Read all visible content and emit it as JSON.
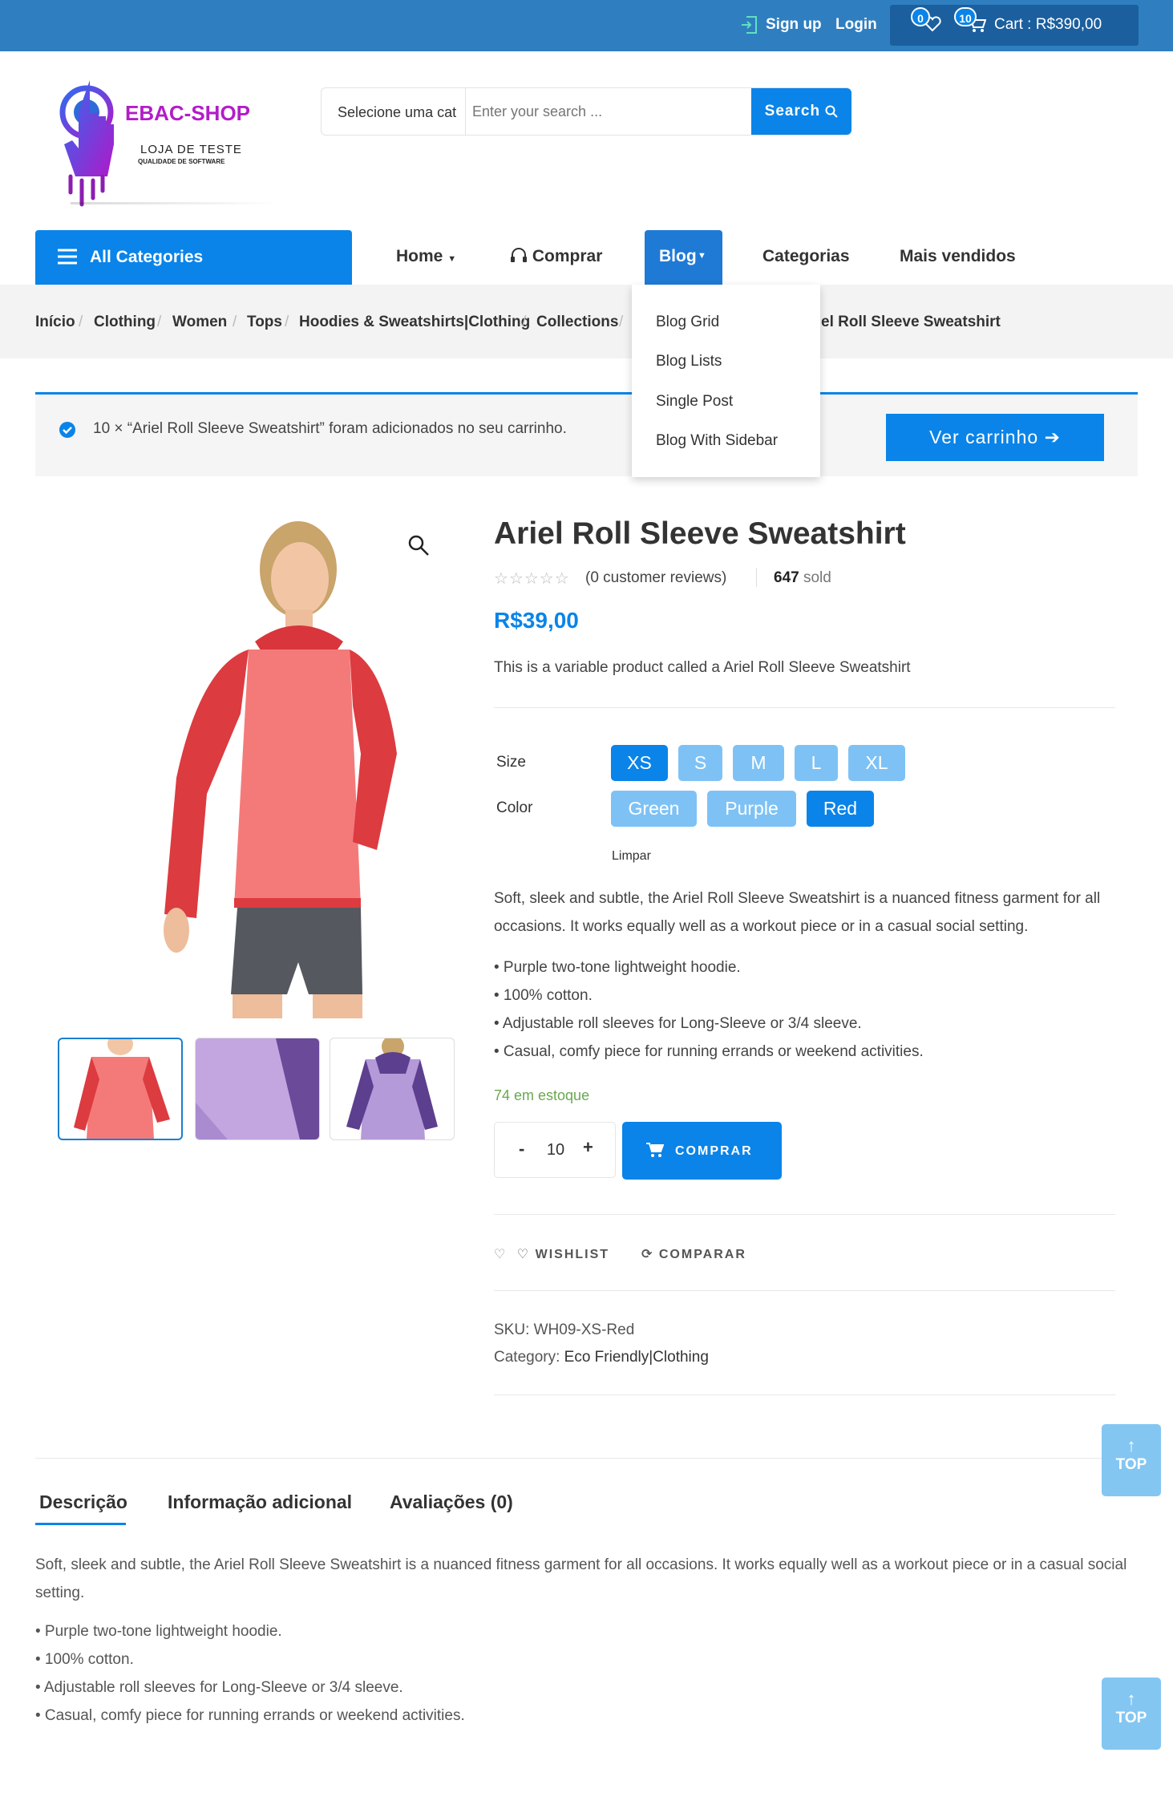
{
  "topbar": {
    "signup": "Sign up",
    "login": "Login",
    "wishlist_count": "0",
    "cart_count": "10",
    "cart_label": "Cart : R$390,00"
  },
  "header": {
    "logo_title": "EBAC-SHOP",
    "logo_sub1": "LOJA DE TESTE",
    "logo_sub2": "QUALIDADE DE SOFTWARE",
    "category_select": "Selecione uma cat",
    "search_placeholder": "Enter your search ...",
    "search_button": "Search"
  },
  "nav": {
    "all_categories": "All Categories",
    "items": [
      "Home",
      "Comprar",
      "Blog",
      "Categorias",
      "Mais vendidos"
    ]
  },
  "blog_menu": [
    "Blog Grid",
    "Blog Lists",
    "Single Post",
    "Blog With Sidebar"
  ],
  "breadcrumb": [
    "Início",
    "Clothing",
    "Women",
    "Tops",
    "Hoodies & Sweatshirts|Clothing",
    "Collections",
    "el Roll Sleeve Sweatshirt"
  ],
  "notice": {
    "message": "10 × “Ariel Roll Sleeve Sweatshirt” foram adicionados no seu carrinho.",
    "button": "Ver carrinho"
  },
  "product": {
    "title": "Ariel Roll Sleeve Sweatshirt",
    "reviews": "(0 customer reviews)",
    "sold_count": "647",
    "sold_label": "sold",
    "price": "R$39,00",
    "short_desc": "This is a variable product called a Ariel Roll Sleeve Sweatshirt",
    "size_label": "Size",
    "sizes": [
      "XS",
      "S",
      "M",
      "L",
      "XL"
    ],
    "selected_size": "XS",
    "color_label": "Color",
    "colors": [
      "Green",
      "Purple",
      "Red"
    ],
    "selected_color": "Red",
    "clear": "Limpar",
    "desc": "Soft, sleek and subtle, the Ariel Roll Sleeve Sweatshirt is a nuanced fitness garment for all occasions. It works equally well as a workout piece or in a casual social setting.",
    "bullets": [
      "• Purple two-tone lightweight hoodie.",
      "• 100% cotton.",
      "• Adjustable roll sleeves for Long-Sleeve or 3/4 sleeve.",
      "• Casual, comfy piece for running errands or weekend activities."
    ],
    "stock": "74 em estoque",
    "qty_minus": "-",
    "qty_value": "10",
    "qty_plus": "+",
    "buy_button": "COMPRAR",
    "wishlist": "WISHLIST",
    "compare": "COMPARAR",
    "sku": "SKU: WH09-XS-Red",
    "category_label": "Category:",
    "category_value": "Eco Friendly|Clothing"
  },
  "tabs": {
    "items": [
      "Descrição",
      "Informação adicional",
      "Avaliações (0)"
    ],
    "active": "Descrição",
    "desc": "Soft, sleek and subtle, the Ariel Roll Sleeve Sweatshirt is a nuanced fitness garment for all occasions. It works equally well as a workout piece or in a casual social setting.",
    "bullets": [
      "• Purple two-tone lightweight hoodie.",
      "• 100% cotton.",
      "• Adjustable roll sleeves for Long-Sleeve or 3/4 sleeve.",
      "• Casual, comfy piece for running errands or weekend activities."
    ]
  },
  "top_button": "TOP",
  "colors": {
    "primary": "#0a84e8",
    "topbar": "#2f7fc0",
    "cartbox": "#1b5f9e",
    "swatch_light": "#7ec2f5",
    "stock_green": "#6aa84f"
  }
}
